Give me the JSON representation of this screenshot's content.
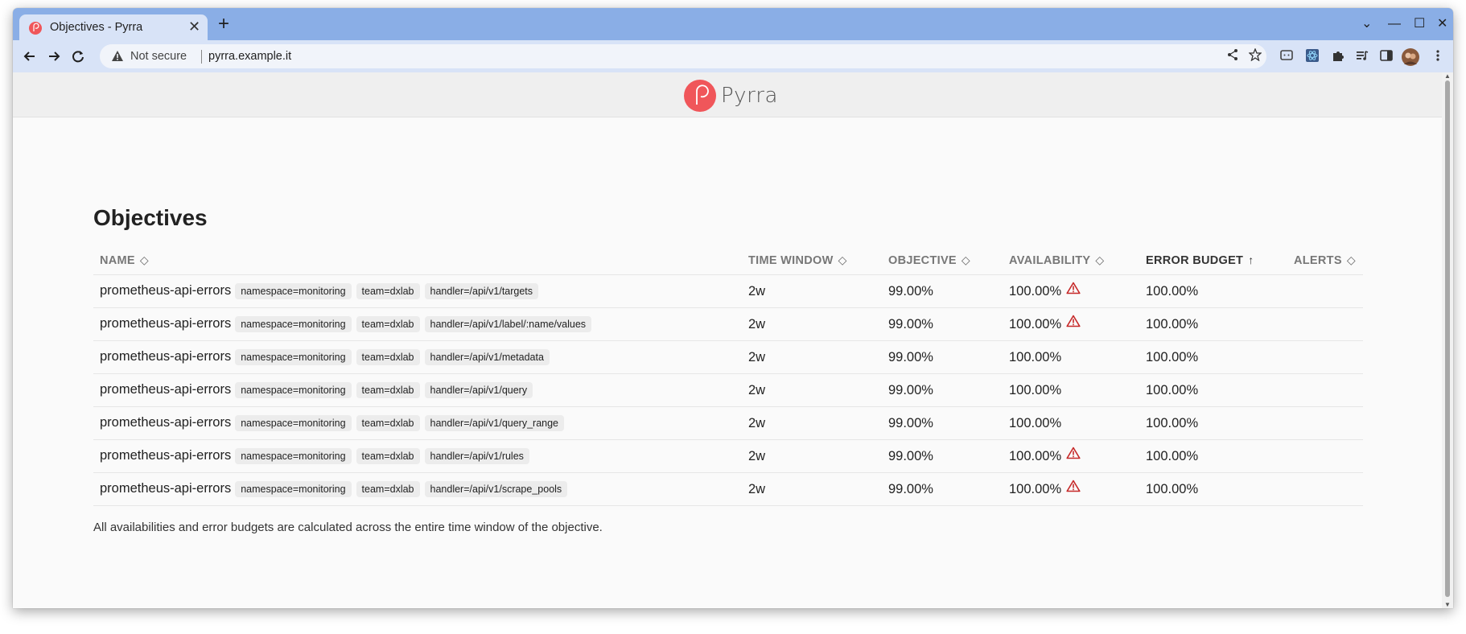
{
  "browser": {
    "tab_title": "Objectives - Pyrra",
    "tab_close": "✕",
    "new_tab": "+",
    "security_label": "Not secure",
    "url": "pyrra.example.it",
    "window_controls": {
      "dropdown": "⌄",
      "minimize": "—",
      "maximize": "☐",
      "close": "✕"
    }
  },
  "app": {
    "brand": "Pyrra",
    "brand_color": "#f0565a"
  },
  "page": {
    "title": "Objectives",
    "footnote": "All availabilities and error budgets are calculated across the entire time window of the objective."
  },
  "table": {
    "columns": [
      {
        "label": "NAME",
        "sort": "◇"
      },
      {
        "label": "TIME WINDOW",
        "sort": "◇"
      },
      {
        "label": "OBJECTIVE",
        "sort": "◇"
      },
      {
        "label": "AVAILABILITY",
        "sort": "◇"
      },
      {
        "label": "ERROR BUDGET",
        "sort": "↑"
      },
      {
        "label": "ALERTS",
        "sort": "◇"
      }
    ],
    "rows": [
      {
        "name": "prometheus-api-errors",
        "labels": [
          "namespace=monitoring",
          "team=dxlab",
          "handler=/api/v1/targets"
        ],
        "window": "2w",
        "objective": "99.00%",
        "availability": "100.00%",
        "alert": true,
        "error_budget": "100.00%"
      },
      {
        "name": "prometheus-api-errors",
        "labels": [
          "namespace=monitoring",
          "team=dxlab",
          "handler=/api/v1/label/:name/values"
        ],
        "window": "2w",
        "objective": "99.00%",
        "availability": "100.00%",
        "alert": true,
        "error_budget": "100.00%"
      },
      {
        "name": "prometheus-api-errors",
        "labels": [
          "namespace=monitoring",
          "team=dxlab",
          "handler=/api/v1/metadata"
        ],
        "window": "2w",
        "objective": "99.00%",
        "availability": "100.00%",
        "alert": false,
        "error_budget": "100.00%"
      },
      {
        "name": "prometheus-api-errors",
        "labels": [
          "namespace=monitoring",
          "team=dxlab",
          "handler=/api/v1/query"
        ],
        "window": "2w",
        "objective": "99.00%",
        "availability": "100.00%",
        "alert": false,
        "error_budget": "100.00%"
      },
      {
        "name": "prometheus-api-errors",
        "labels": [
          "namespace=monitoring",
          "team=dxlab",
          "handler=/api/v1/query_range"
        ],
        "window": "2w",
        "objective": "99.00%",
        "availability": "100.00%",
        "alert": false,
        "error_budget": "100.00%"
      },
      {
        "name": "prometheus-api-errors",
        "labels": [
          "namespace=monitoring",
          "team=dxlab",
          "handler=/api/v1/rules"
        ],
        "window": "2w",
        "objective": "99.00%",
        "availability": "100.00%",
        "alert": true,
        "error_budget": "100.00%"
      },
      {
        "name": "prometheus-api-errors",
        "labels": [
          "namespace=monitoring",
          "team=dxlab",
          "handler=/api/v1/scrape_pools"
        ],
        "window": "2w",
        "objective": "99.00%",
        "availability": "100.00%",
        "alert": true,
        "error_budget": "100.00%"
      }
    ],
    "alert_color": "#c62828"
  }
}
